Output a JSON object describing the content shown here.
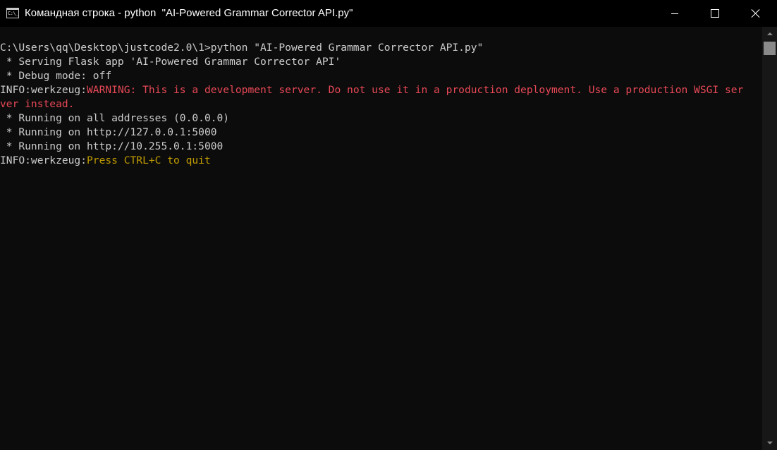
{
  "window": {
    "title": "Командная строка - python  \"AI-Powered Grammar Corrector API.py\"",
    "icon_glyph": "C:\\_"
  },
  "controls": {
    "minimize_icon": "minimize-icon",
    "maximize_icon": "maximize-icon",
    "close_icon": "close-icon"
  },
  "console": {
    "lines": [
      {
        "plain": "C:\\Users\\qq\\Desktop\\justcode2.0\\1>python \"AI-Powered Grammar Corrector API.py\""
      },
      {
        "plain": " * Serving Flask app 'AI-Powered Grammar Corrector API'"
      },
      {
        "plain": " * Debug mode: off"
      },
      {
        "prefix": "INFO:werkzeug:",
        "warning": "WARNING: This is a development server. Do not use it in a production deployment. Use a production WSGI ser"
      },
      {
        "warning": "ver instead."
      },
      {
        "plain": " * Running on all addresses (0.0.0.0)"
      },
      {
        "plain": " * Running on http://127.0.0.1:5000"
      },
      {
        "plain": " * Running on http://10.255.0.1:5000"
      },
      {
        "prefix": "INFO:werkzeug:",
        "press": "Press CTRL+C to quit"
      }
    ]
  },
  "colors": {
    "background": "#0c0c0c",
    "text": "#cccccc",
    "warning": "#e74856",
    "press": "#c19c00"
  }
}
